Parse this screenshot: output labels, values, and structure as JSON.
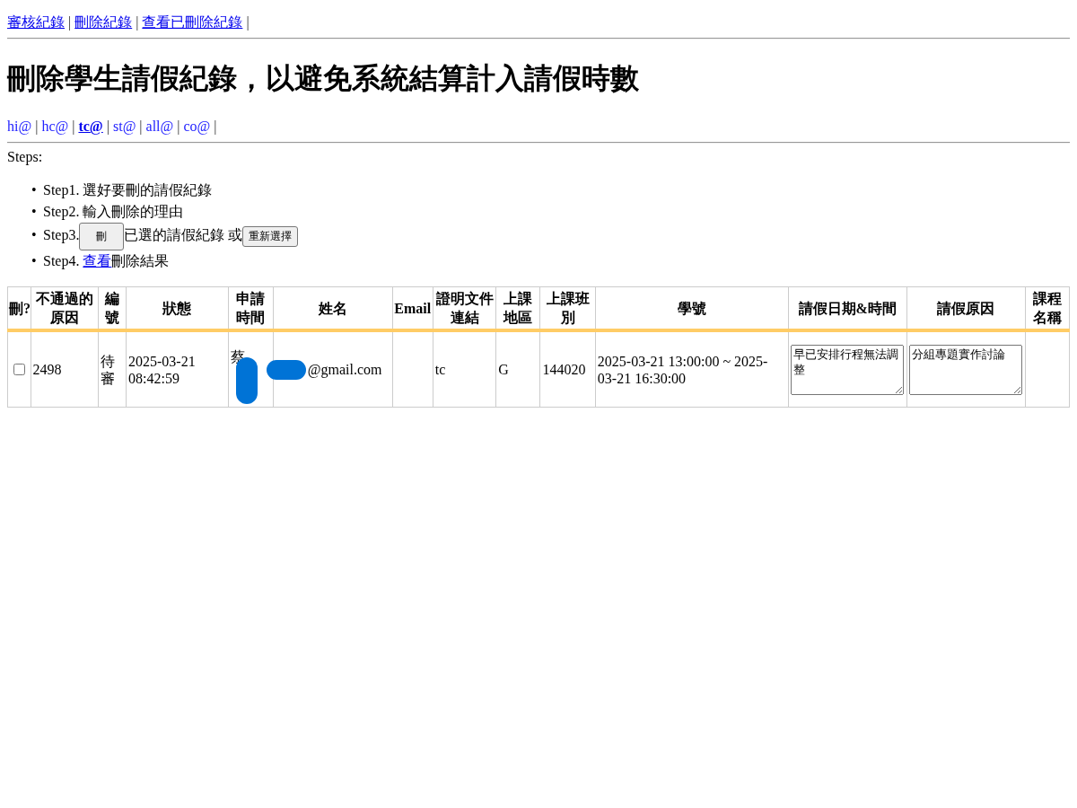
{
  "top_links": [
    {
      "label": "審核紀錄",
      "separator": "|"
    },
    {
      "label": "刪除紀錄",
      "separator": "|"
    },
    {
      "label": "查看已刪除紀錄",
      "separator": "|"
    }
  ],
  "title": "刪除學生請假紀錄，以避免系統結算計入請假時數",
  "group_links": [
    {
      "label": "hi@",
      "selected": false,
      "separator": "|"
    },
    {
      "label": "hc@",
      "selected": false,
      "separator": "|"
    },
    {
      "label": "tc@",
      "selected": true,
      "separator": "|"
    },
    {
      "label": "st@",
      "selected": false,
      "separator": "|"
    },
    {
      "label": "all@",
      "selected": false,
      "separator": "|"
    },
    {
      "label": "co@",
      "selected": false,
      "separator": "|"
    }
  ],
  "steps_label": "Steps:",
  "steps": [
    {
      "bullet": "•",
      "parts": [
        {
          "kind": "text",
          "text": "Step1. 選好要刪的請假紀錄"
        }
      ]
    },
    {
      "bullet": "•",
      "parts": [
        {
          "kind": "text",
          "text": "Step2. 輸入刪除的理由"
        }
      ]
    },
    {
      "bullet": "•",
      "parts": [
        {
          "kind": "text",
          "text": "Step3."
        },
        {
          "kind": "button",
          "text": "刪"
        },
        {
          "kind": "text",
          "text": "已選的請假紀錄 或"
        },
        {
          "kind": "button",
          "text": "重新選擇"
        }
      ]
    },
    {
      "bullet": "•",
      "parts": [
        {
          "kind": "text",
          "text": "Step4."
        },
        {
          "kind": "link",
          "text": "查看"
        },
        {
          "kind": "text",
          "text": "刪除結果"
        }
      ]
    }
  ],
  "table": {
    "columns": [
      "刪?",
      "不通過的原因",
      "編號",
      "狀態",
      "申請時間",
      "姓名",
      "Email",
      "證明文件連結",
      "上課地區",
      "上課班別",
      "學號",
      "請假日期&時間",
      "請假原因",
      "課程名稱"
    ],
    "rows": [
      {
        "cells": [
          {
            "kind": "checkbox",
            "checked": false
          },
          {
            "kind": "text",
            "text": "2498"
          },
          {
            "kind": "text",
            "text": "待審"
          },
          {
            "kind": "text",
            "text": "2025-03-21 08:42:59"
          },
          {
            "kind": "text",
            "text": "蔡",
            "redacted": true
          },
          {
            "kind": "text",
            "text": "@gmail.com",
            "redacted": true
          },
          {
            "kind": "empty"
          },
          {
            "kind": "text",
            "text": "tc"
          },
          {
            "kind": "text",
            "text": "G"
          },
          {
            "kind": "text",
            "text": "144020"
          },
          {
            "kind": "text",
            "text": "2025-03-21 13:00:00 ~ 2025-03-21 16:30:00"
          },
          {
            "kind": "textarea",
            "text": "早已安排行程無法調整"
          },
          {
            "kind": "textarea",
            "text": "分組專題實作討論"
          },
          {
            "kind": "empty"
          }
        ]
      }
    ]
  }
}
